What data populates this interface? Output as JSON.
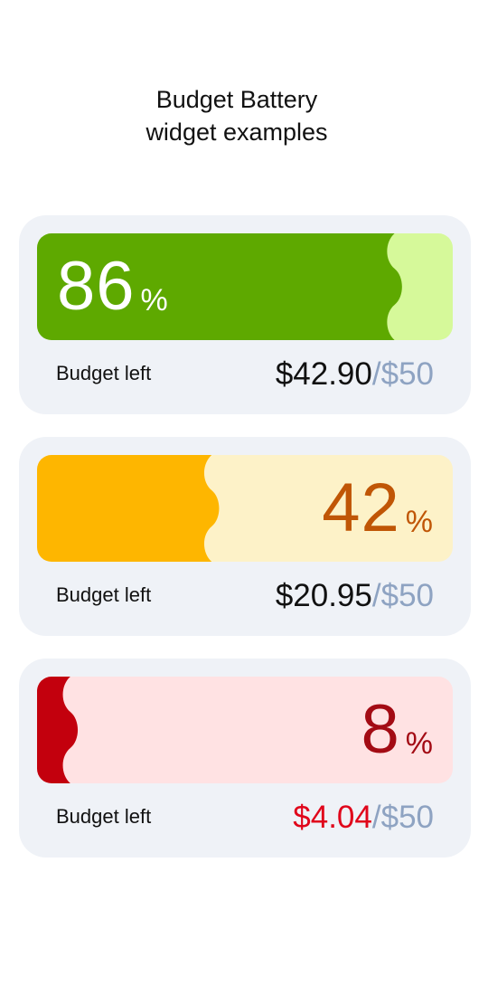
{
  "title": {
    "line1": "Budget Battery",
    "line2": "widget examples"
  },
  "widgets": [
    {
      "percent": "86",
      "percent_sign": "%",
      "level": 0.86,
      "label": "Budget left",
      "spent": "$42.90",
      "total": "/$50",
      "colors": {
        "fill": "#5ea900",
        "track": "#d6f99a",
        "percent_text": "#ffffff",
        "amount_text": "#111111"
      }
    },
    {
      "percent": "42",
      "percent_sign": "%",
      "level": 0.42,
      "label": "Budget left",
      "spent": "$20.95",
      "total": "/$50",
      "colors": {
        "fill": "#feb600",
        "track": "#fdf2c8",
        "percent_text": "#c05606",
        "amount_text": "#111111"
      }
    },
    {
      "percent": "8",
      "percent_sign": "%",
      "level": 0.08,
      "label": "Budget left",
      "spent": "$4.04",
      "total": "/$50",
      "colors": {
        "fill": "#c3000d",
        "track": "#ffe2e3",
        "percent_text": "#a30b14",
        "amount_text": "#e0061b"
      }
    }
  ]
}
